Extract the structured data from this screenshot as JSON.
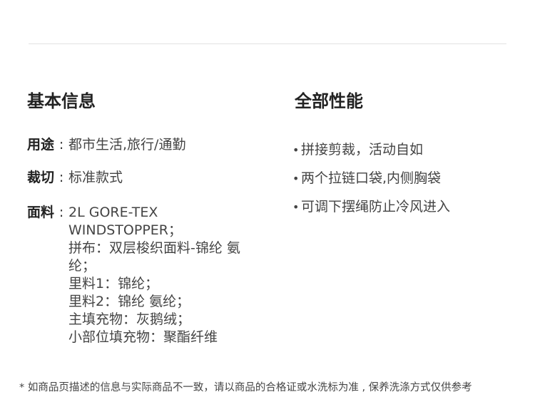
{
  "basic_info": {
    "title": "基本信息",
    "usage": {
      "label": "用途",
      "colon": ":",
      "value": "都市生活,旅行/通勤"
    },
    "cut": {
      "label": "裁切",
      "colon": ":",
      "value": "标准款式"
    },
    "fabric": {
      "label": "面料",
      "colon": ":",
      "lines": [
        "2L GORE-TEX WINDSTOPPER；",
        "拼布：双层梭织面料-锦纶 氨纶；",
        "里料1：锦纶；",
        "里料2：锦纶 氨纶；",
        "主填充物：灰鹅绒；",
        "小部位填充物：聚酯纤维"
      ]
    }
  },
  "performance": {
    "title": "全部性能",
    "bullet": "•",
    "items": [
      "拼接剪裁，活动自如",
      "两个拉链口袋,内侧胸袋",
      "可调下摆绳防止冷风进入"
    ]
  },
  "footnote": "* 如商品页描述的信息与实际商品不一致，请以商品的合格证或水洗标为准 , 保养洗涤方式仅供参考"
}
